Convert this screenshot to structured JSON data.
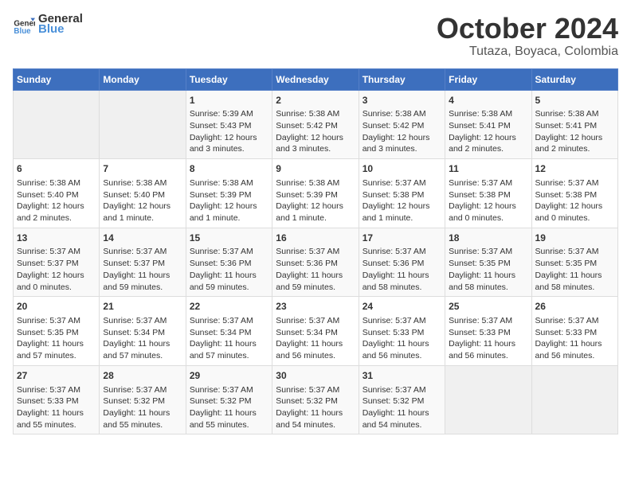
{
  "header": {
    "logo_general": "General",
    "logo_blue": "Blue",
    "month_title": "October 2024",
    "location": "Tutaza, Boyaca, Colombia"
  },
  "weekdays": [
    "Sunday",
    "Monday",
    "Tuesday",
    "Wednesday",
    "Thursday",
    "Friday",
    "Saturday"
  ],
  "weeks": [
    [
      {
        "day": "",
        "content": ""
      },
      {
        "day": "",
        "content": ""
      },
      {
        "day": "1",
        "content": "Sunrise: 5:39 AM\nSunset: 5:43 PM\nDaylight: 12 hours and 3 minutes."
      },
      {
        "day": "2",
        "content": "Sunrise: 5:38 AM\nSunset: 5:42 PM\nDaylight: 12 hours and 3 minutes."
      },
      {
        "day": "3",
        "content": "Sunrise: 5:38 AM\nSunset: 5:42 PM\nDaylight: 12 hours and 3 minutes."
      },
      {
        "day": "4",
        "content": "Sunrise: 5:38 AM\nSunset: 5:41 PM\nDaylight: 12 hours and 2 minutes."
      },
      {
        "day": "5",
        "content": "Sunrise: 5:38 AM\nSunset: 5:41 PM\nDaylight: 12 hours and 2 minutes."
      }
    ],
    [
      {
        "day": "6",
        "content": "Sunrise: 5:38 AM\nSunset: 5:40 PM\nDaylight: 12 hours and 2 minutes."
      },
      {
        "day": "7",
        "content": "Sunrise: 5:38 AM\nSunset: 5:40 PM\nDaylight: 12 hours and 1 minute."
      },
      {
        "day": "8",
        "content": "Sunrise: 5:38 AM\nSunset: 5:39 PM\nDaylight: 12 hours and 1 minute."
      },
      {
        "day": "9",
        "content": "Sunrise: 5:38 AM\nSunset: 5:39 PM\nDaylight: 12 hours and 1 minute."
      },
      {
        "day": "10",
        "content": "Sunrise: 5:37 AM\nSunset: 5:38 PM\nDaylight: 12 hours and 1 minute."
      },
      {
        "day": "11",
        "content": "Sunrise: 5:37 AM\nSunset: 5:38 PM\nDaylight: 12 hours and 0 minutes."
      },
      {
        "day": "12",
        "content": "Sunrise: 5:37 AM\nSunset: 5:38 PM\nDaylight: 12 hours and 0 minutes."
      }
    ],
    [
      {
        "day": "13",
        "content": "Sunrise: 5:37 AM\nSunset: 5:37 PM\nDaylight: 12 hours and 0 minutes."
      },
      {
        "day": "14",
        "content": "Sunrise: 5:37 AM\nSunset: 5:37 PM\nDaylight: 11 hours and 59 minutes."
      },
      {
        "day": "15",
        "content": "Sunrise: 5:37 AM\nSunset: 5:36 PM\nDaylight: 11 hours and 59 minutes."
      },
      {
        "day": "16",
        "content": "Sunrise: 5:37 AM\nSunset: 5:36 PM\nDaylight: 11 hours and 59 minutes."
      },
      {
        "day": "17",
        "content": "Sunrise: 5:37 AM\nSunset: 5:36 PM\nDaylight: 11 hours and 58 minutes."
      },
      {
        "day": "18",
        "content": "Sunrise: 5:37 AM\nSunset: 5:35 PM\nDaylight: 11 hours and 58 minutes."
      },
      {
        "day": "19",
        "content": "Sunrise: 5:37 AM\nSunset: 5:35 PM\nDaylight: 11 hours and 58 minutes."
      }
    ],
    [
      {
        "day": "20",
        "content": "Sunrise: 5:37 AM\nSunset: 5:35 PM\nDaylight: 11 hours and 57 minutes."
      },
      {
        "day": "21",
        "content": "Sunrise: 5:37 AM\nSunset: 5:34 PM\nDaylight: 11 hours and 57 minutes."
      },
      {
        "day": "22",
        "content": "Sunrise: 5:37 AM\nSunset: 5:34 PM\nDaylight: 11 hours and 57 minutes."
      },
      {
        "day": "23",
        "content": "Sunrise: 5:37 AM\nSunset: 5:34 PM\nDaylight: 11 hours and 56 minutes."
      },
      {
        "day": "24",
        "content": "Sunrise: 5:37 AM\nSunset: 5:33 PM\nDaylight: 11 hours and 56 minutes."
      },
      {
        "day": "25",
        "content": "Sunrise: 5:37 AM\nSunset: 5:33 PM\nDaylight: 11 hours and 56 minutes."
      },
      {
        "day": "26",
        "content": "Sunrise: 5:37 AM\nSunset: 5:33 PM\nDaylight: 11 hours and 56 minutes."
      }
    ],
    [
      {
        "day": "27",
        "content": "Sunrise: 5:37 AM\nSunset: 5:33 PM\nDaylight: 11 hours and 55 minutes."
      },
      {
        "day": "28",
        "content": "Sunrise: 5:37 AM\nSunset: 5:32 PM\nDaylight: 11 hours and 55 minutes."
      },
      {
        "day": "29",
        "content": "Sunrise: 5:37 AM\nSunset: 5:32 PM\nDaylight: 11 hours and 55 minutes."
      },
      {
        "day": "30",
        "content": "Sunrise: 5:37 AM\nSunset: 5:32 PM\nDaylight: 11 hours and 54 minutes."
      },
      {
        "day": "31",
        "content": "Sunrise: 5:37 AM\nSunset: 5:32 PM\nDaylight: 11 hours and 54 minutes."
      },
      {
        "day": "",
        "content": ""
      },
      {
        "day": "",
        "content": ""
      }
    ]
  ]
}
